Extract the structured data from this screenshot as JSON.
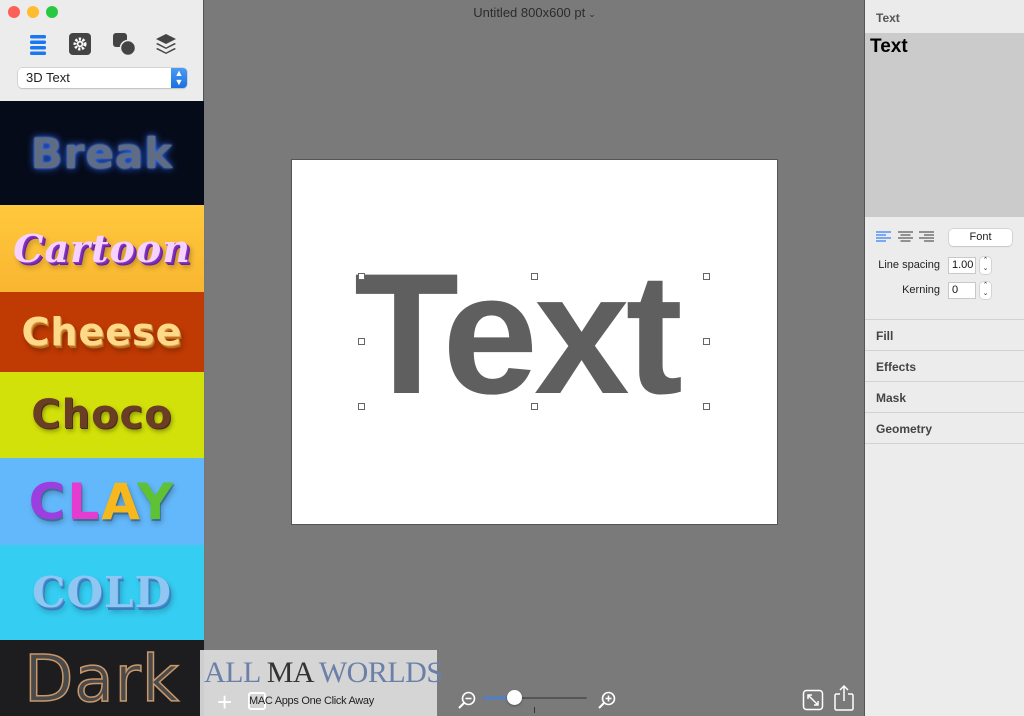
{
  "window": {
    "title": "Untitled 800x600 pt",
    "controls": [
      "close",
      "minimize",
      "zoom"
    ]
  },
  "sidebar": {
    "toolbar": [
      {
        "icon": "list-icon",
        "active": true
      },
      {
        "icon": "gear-icon",
        "active": false
      },
      {
        "icon": "shapes-icon",
        "active": false
      },
      {
        "icon": "layers-icon",
        "active": false
      }
    ],
    "category_select": {
      "value": "3D Text"
    },
    "styles": [
      {
        "name": "Break"
      },
      {
        "name": "Cartoon"
      },
      {
        "name": "Cheese"
      },
      {
        "name": "Choco"
      },
      {
        "name": "CLAY"
      },
      {
        "name": "COLD"
      },
      {
        "name": "Dark"
      }
    ]
  },
  "canvas": {
    "text": "Text",
    "text_color": "#5f5f5f",
    "background": "#ffffff"
  },
  "bottom_bar": {
    "add_label": "+",
    "zoom_level": 0.3,
    "accent": "#3a82f0"
  },
  "watermark": {
    "title_left": "ALL ",
    "title_mid": "MA",
    "title_right": " WORLDS",
    "subtitle": "MAC Apps One Click Away"
  },
  "inspector": {
    "header": "Text",
    "preview_text": "Text",
    "alignment": [
      "left",
      "center",
      "right"
    ],
    "active_alignment": "left",
    "font_button": "Font",
    "line_spacing": {
      "label": "Line spacing",
      "value": "1.00"
    },
    "kerning": {
      "label": "Kerning",
      "value": "0"
    },
    "sections": [
      "Fill",
      "Effects",
      "Mask",
      "Geometry"
    ]
  }
}
